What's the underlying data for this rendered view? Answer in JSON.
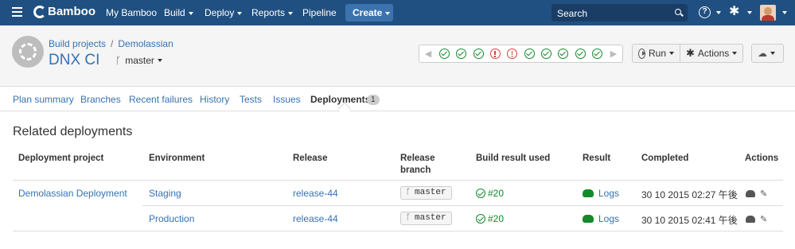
{
  "topnav": {
    "logo": "Bamboo",
    "items": [
      {
        "label": "My Bamboo",
        "caret": false
      },
      {
        "label": "Build",
        "caret": true
      },
      {
        "label": "Deploy",
        "caret": true
      },
      {
        "label": "Reports",
        "caret": true
      },
      {
        "label": "Pipeline",
        "caret": false
      }
    ],
    "create_label": "Create",
    "search_placeholder": "Search",
    "icons": [
      "menu-icon",
      "search-icon",
      "help-icon",
      "gear-icon",
      "avatar"
    ],
    "colors": {
      "bar": "#205081",
      "create": "#3b73af"
    }
  },
  "header": {
    "breadcrumbs": [
      "Build projects",
      "Demolassian"
    ],
    "plan_title": "DNX CI",
    "branch": "master",
    "history": [
      "ok",
      "ok",
      "ok",
      "fail",
      "fail",
      "ok",
      "ok",
      "ok",
      "ok",
      "ok"
    ],
    "run_label": "Run",
    "actions_label": "Actions"
  },
  "tabs": {
    "items": [
      "Plan summary",
      "Branches",
      "Recent failures",
      "History",
      "Tests",
      "Issues",
      "Deployments"
    ],
    "active": "Deployments",
    "deployments_count": "1"
  },
  "main": {
    "title": "Related deployments",
    "columns": {
      "project": "Deployment project",
      "environment": "Environment",
      "release": "Release",
      "release_branch_1": "Release",
      "release_branch_2": "branch",
      "build_result": "Build result used",
      "result": "Result",
      "completed": "Completed",
      "actions": "Actions"
    },
    "rows": [
      {
        "project": "Demolassian Deployment",
        "environment": "Staging",
        "release": "release-44",
        "branch": "master",
        "build": "#20",
        "result": "Logs",
        "completed": "30 10 2015 02:27 午後"
      },
      {
        "project": "",
        "environment": "Production",
        "release": "release-44",
        "branch": "master",
        "build": "#20",
        "result": "Logs",
        "completed": "30 10 2015 02:41 午後"
      }
    ],
    "colors": {
      "link": "#3572b0",
      "success": "#14892c",
      "failure": "#d04437"
    }
  }
}
